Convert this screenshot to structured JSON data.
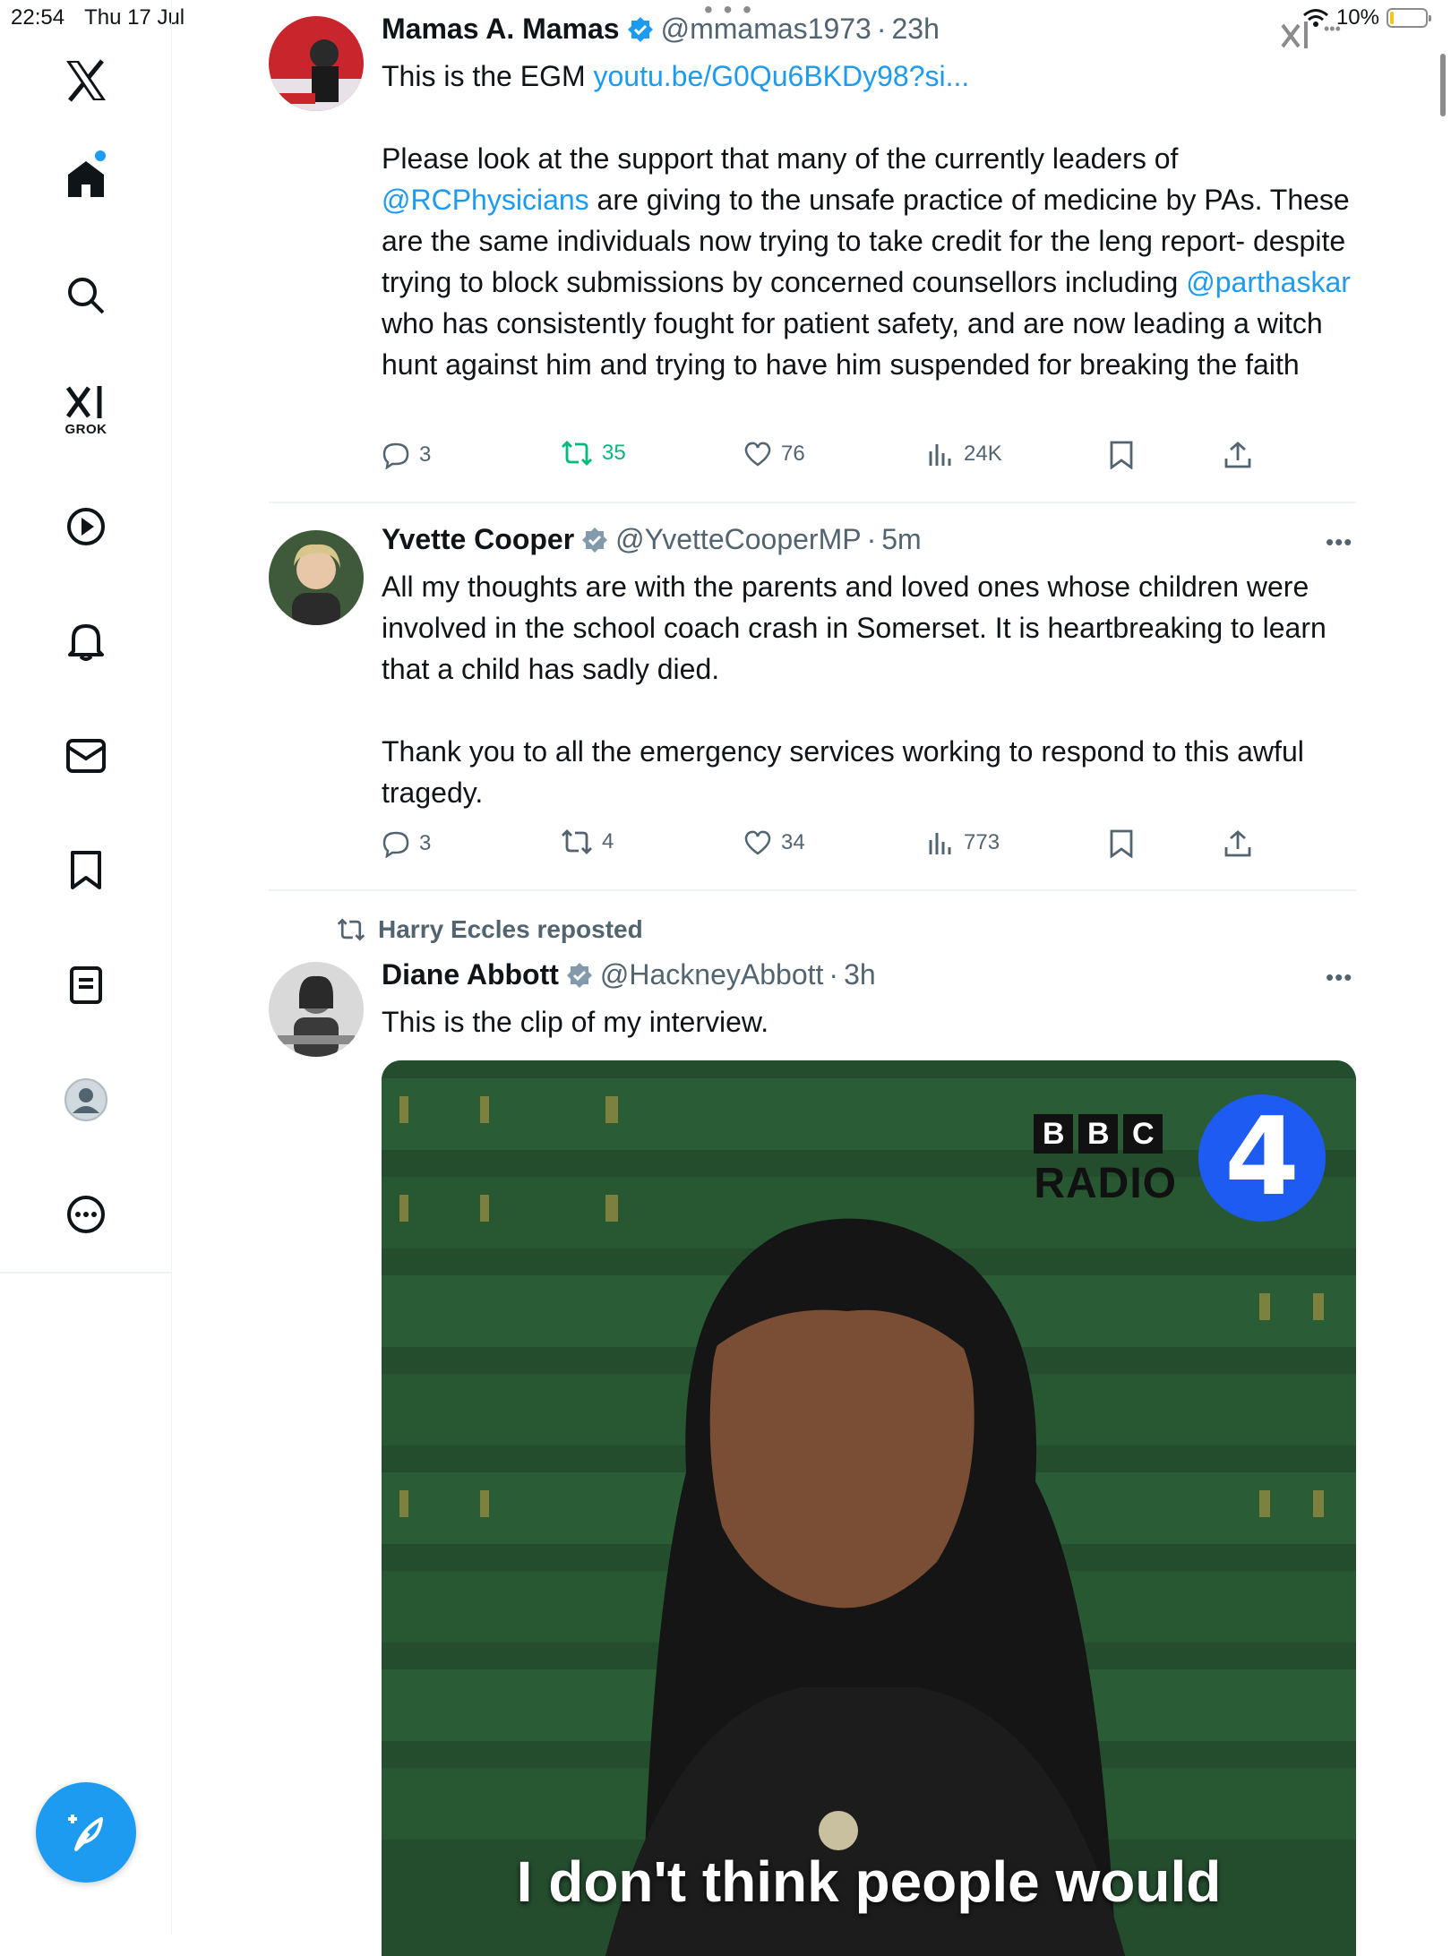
{
  "status_bar": {
    "time": "22:54",
    "date": "Thu 17 Jul",
    "battery": "10%",
    "battery_level": 0.1
  },
  "sidebar": {
    "grok_label": "GROK"
  },
  "tweets": [
    {
      "name": "Mamas A. Mamas",
      "handle": "@mmamas1973",
      "time": "23h",
      "text_line1_prefix": "This is the EGM ",
      "text_line1_link": "youtu.be/G0Qu6BKDy98?si...",
      "paragraph2": {
        "part1": "Please look at the support that many of the currently leaders of ",
        "mention1": "@RCPhysicians",
        "part2": " are giving to the unsafe practice of medicine by PAs. These are the same individuals now trying to take credit for the leng report- despite trying to block submissions by concerned counsellors including ",
        "mention2": "@parthaskar",
        "part3": " who has consistently fought for patient safety, and are now leading a witch hunt against him and trying to have him suspended for breaking the faith"
      },
      "replies": "3",
      "reposts": "35",
      "likes": "76",
      "views": "24K"
    },
    {
      "name": "Yvette Cooper",
      "handle": "@YvetteCooperMP",
      "time": "5m",
      "paragraph1": "All my thoughts are with the parents and loved ones whose children were involved in the school coach crash in Somerset. It is heartbreaking to learn that a child has sadly died.",
      "paragraph2": "Thank you to all the emergency services working to respond to this awful tragedy.",
      "replies": "3",
      "reposts": "4",
      "likes": "34",
      "views": "773"
    },
    {
      "reposted_by": "Harry Eccles reposted",
      "name": "Diane Abbott",
      "handle": "@HackneyAbbott",
      "time": "3h",
      "text": "This is the clip of my interview.",
      "media": {
        "bbc_letters": [
          "B",
          "B",
          "C"
        ],
        "bbc_radio": "RADIO",
        "radio_number": "4",
        "caption_line1": "I don't think people would"
      }
    }
  ],
  "colors": {
    "accent": "#1d9bf0",
    "repost_green": "#00ba7c",
    "secondary_text": "#536471"
  }
}
